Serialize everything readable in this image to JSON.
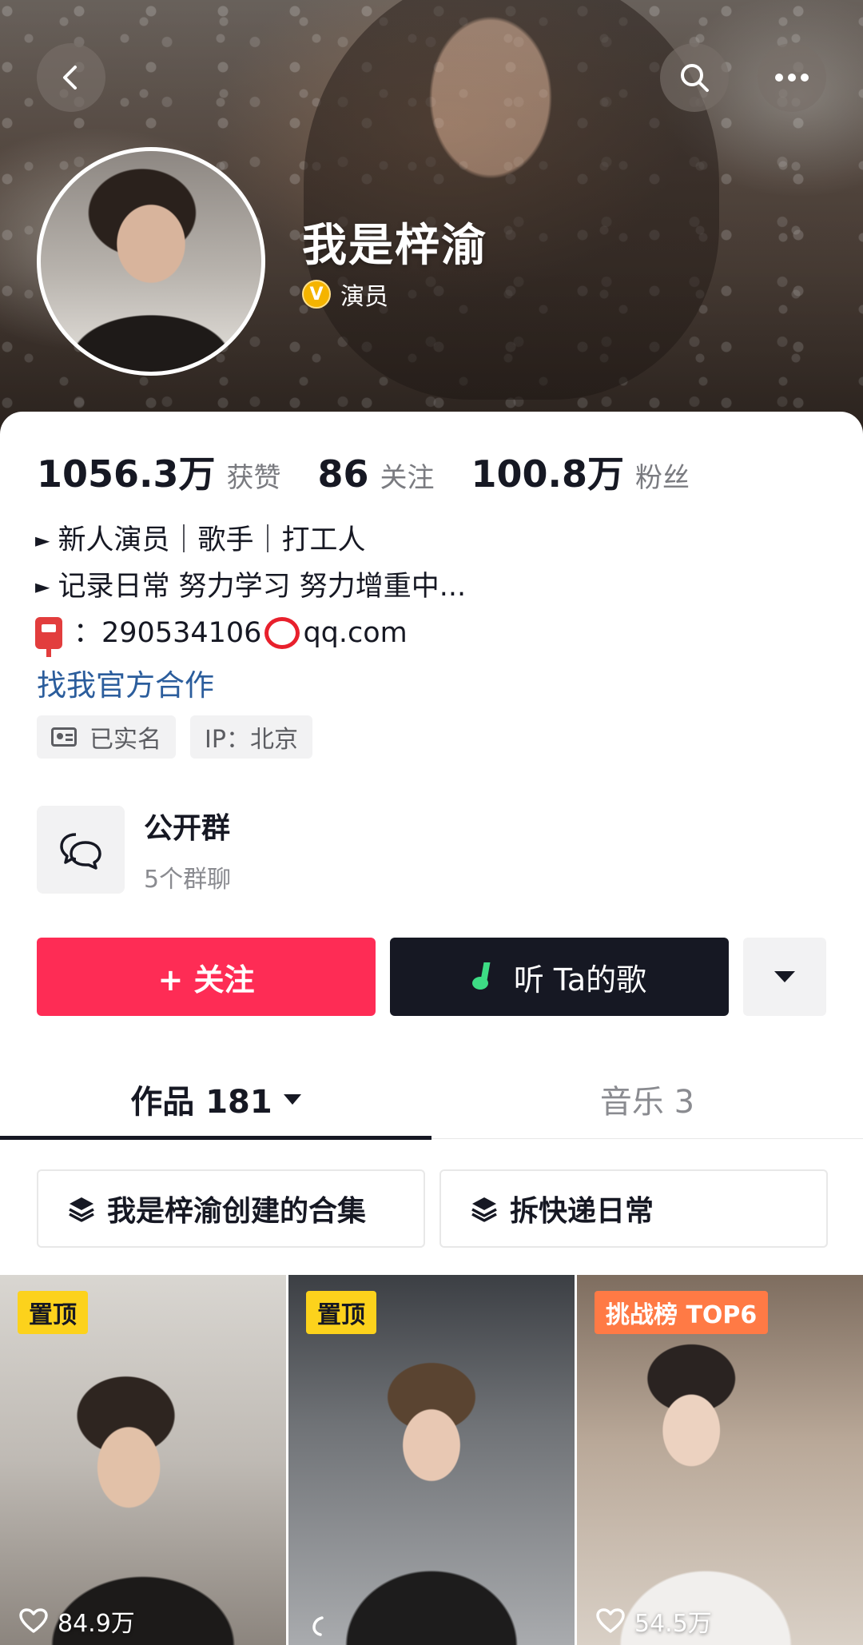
{
  "profile": {
    "name": "我是梓渝",
    "verified_label": "演员",
    "verified_badge": "V"
  },
  "stats": [
    {
      "value": "1056.3万",
      "label": "获赞"
    },
    {
      "value": "86",
      "label": "关注"
    },
    {
      "value": "100.8万",
      "label": "粉丝"
    }
  ],
  "bio": {
    "line1": "新人演员｜歌手｜打工人",
    "line2": "记录日常 努力学习 努力增重中...",
    "email_prefix": "：",
    "email_user": "290534106",
    "email_domain": "qq.com",
    "cooperation_link": "找我官方合作"
  },
  "tags": {
    "real_name": "已实名",
    "ip": "IP：北京"
  },
  "group": {
    "title": "公开群",
    "subtitle": "5个群聊"
  },
  "actions": {
    "follow": "+ 关注",
    "listen": "听 Ta的歌"
  },
  "tabs": {
    "works": "作品 181",
    "music": "音乐 3"
  },
  "collections": [
    "我是梓渝创建的合集",
    "拆快递日常"
  ],
  "videos": [
    {
      "badge": "置顶",
      "likes": "84.9万"
    },
    {
      "badge": "置顶",
      "likes": ""
    },
    {
      "badge": "挑战榜 TOP6",
      "likes": "54.5万"
    }
  ],
  "colors": {
    "follow_button": "#fe2c55",
    "listen_button": "#161823",
    "link": "#2b5d9c",
    "pin_badge": "#fcd21c",
    "challenge_badge": "#ff7a45"
  }
}
